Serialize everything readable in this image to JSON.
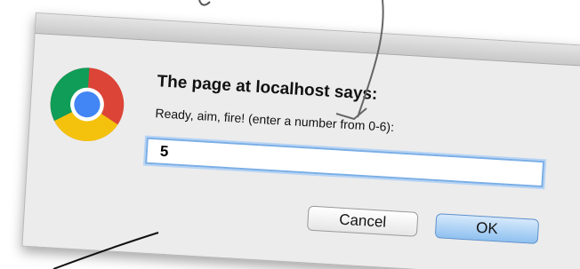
{
  "dialog": {
    "heading": "The page at localhost says:",
    "message": "Ready, aim, fire! (enter a number from 0-6):",
    "input_value": "5",
    "cancel_label": "Cancel",
    "ok_label": "OK"
  },
  "icons": {
    "app_icon": "chrome-logo-icon"
  },
  "colors": {
    "chrome_red": "#db4437",
    "chrome_yellow": "#f4c20d",
    "chrome_green": "#0f9d58",
    "chrome_blue": "#4285f4",
    "ok_button": "#8fc1f0",
    "input_focus_ring": "#7aaee6"
  }
}
